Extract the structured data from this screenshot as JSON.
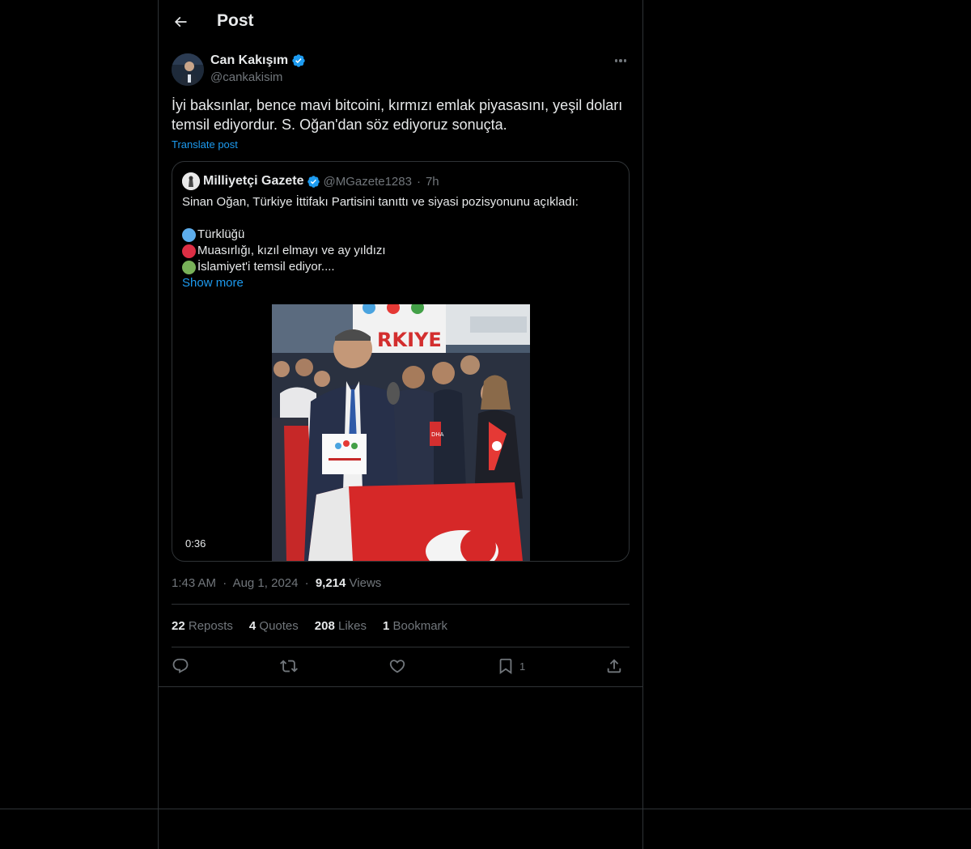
{
  "header": {
    "title": "Post"
  },
  "author": {
    "name": "Can Kakışım",
    "handle": "@cankakisim"
  },
  "post": {
    "text": "İyi baksınlar, bence mavi bitcoini, kırmızı emlak piyasasını, yeşil doları temsil ediyordur. S. Oğan'dan söz ediyoruz sonuçta.",
    "translate_label": "Translate post"
  },
  "quote": {
    "name": "Milliyetçi Gazete",
    "handle": "@MGazete1283",
    "separator": "·",
    "time": "7h",
    "intro": "Sinan Oğan, Türkiye İttifakı Partisini tanıttı ve siyasi pozisyonunu açıkladı:",
    "lines": [
      {
        "color": "#5dadec",
        "text": "Türklüğü"
      },
      {
        "color": "#dd2e44",
        "text": "Muasırlığı, kızıl elmayı ve ay yıldızı"
      },
      {
        "color": "#78b159",
        "text": "İslamiyet'i temsil ediyor...."
      }
    ],
    "show_more": "Show more",
    "video_duration": "0:36"
  },
  "meta": {
    "time": "1:43 AM",
    "dot1": "·",
    "date": "Aug 1, 2024",
    "dot2": "·",
    "views_count": "9,214",
    "views_label": "Views"
  },
  "stats": {
    "reposts_count": "22",
    "reposts_label": "Reposts",
    "quotes_count": "4",
    "quotes_label": "Quotes",
    "likes_count": "208",
    "likes_label": "Likes",
    "bookmarks_count": "1",
    "bookmarks_label": "Bookmark"
  },
  "actions": {
    "bookmark_count": "1"
  },
  "colors": {
    "accent": "#1d9bf0",
    "muted": "#71767b",
    "text": "#e7e9ea",
    "border": "#2f3336",
    "background": "#000000"
  }
}
